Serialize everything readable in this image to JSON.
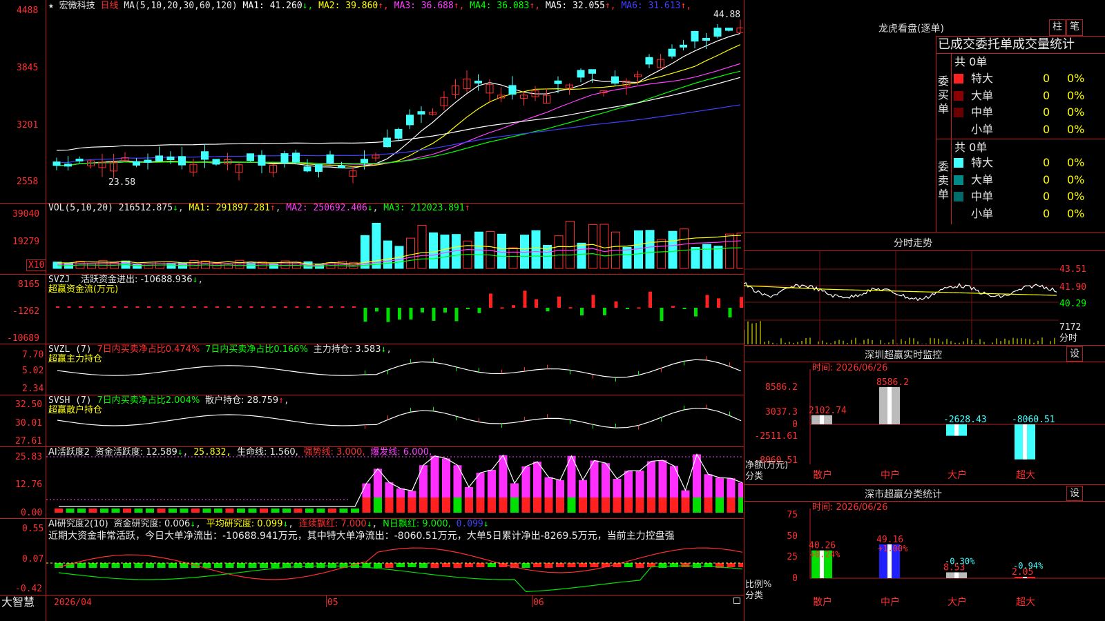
{
  "stock": {
    "name": "宏微科技",
    "period": "日线",
    "star": "★"
  },
  "main_chart": {
    "ma_header": "MA(5,10,20,30,60,120)",
    "ma": [
      {
        "label": "MA1: 41.260",
        "arrow": "↓",
        "color": "#ffffff"
      },
      {
        "label": "MA2: 39.860",
        "arrow": "↑",
        "color": "#ffff00"
      },
      {
        "label": "MA3: 36.688",
        "arrow": "↑",
        "color": "#ff40ff"
      },
      {
        "label": "MA4: 36.083",
        "arrow": "↑",
        "color": "#00ff00"
      },
      {
        "label": "MA5: 32.055",
        "arrow": "↑",
        "color": "#ffffff"
      },
      {
        "label": "MA6: 31.613",
        "arrow": "↑",
        "color": "#4040ff"
      }
    ],
    "y_ticks": [
      "4488",
      "3845",
      "3201",
      "2558"
    ],
    "high_marker": "44.88",
    "low_marker": "23.58"
  },
  "volume": {
    "header": "VOL(5,10,20)",
    "value": "216512.875",
    "ma1": "MA1: 291897.281",
    "ma2": "MA2: 250692.406",
    "ma3": "MA3: 212023.891",
    "y_ticks": [
      "39040",
      "19279"
    ],
    "unit": "X10"
  },
  "svzj": {
    "header": "SVZJ",
    "line": "活跃资金进出: -10688.936",
    "sub": "超赢资金流(万元)",
    "y_ticks": [
      "8165",
      "-1262",
      "-10689"
    ]
  },
  "svzl": {
    "header": "SVZL (7)",
    "a": "7日内买卖净占比0.474%",
    "b": "7日内买卖净占比0.166%",
    "c": "主力持仓: 3.583",
    "sub": "超赢主力持仓",
    "y_ticks": [
      "7.70",
      "5.02",
      "2.34"
    ]
  },
  "svsh": {
    "header": "SVSH (7)",
    "a": "7日内买卖净占比2.004%",
    "b": "散户持仓: 28.759",
    "sub": "超赢散户持仓",
    "y_ticks": [
      "32.50",
      "30.01",
      "27.61"
    ]
  },
  "ai_active": {
    "header": "AI活跃度2",
    "a": "资金活跃度: 12.589",
    "b": "25.832,",
    "c": "生命线: 1.560,",
    "d": "强势线: 3.000,",
    "e": "爆发线: 6.000,",
    "y_ticks": [
      "25.83",
      "12.76",
      "0.00"
    ]
  },
  "ai_research": {
    "header": "AI研究度2(10)",
    "a": "资金研究度: 0.006",
    "b": "平均研究度: 0.099",
    "c": "连续飘红: 7.000",
    "d": "N日飘红: 9.000,",
    "e": "0.099",
    "commentary": "近期大资金非常活跃，今日大单净流出：-10688.941万元，其中特大单净流出：-8060.51万元，大单5日累计净出-8269.5万元，当前主力控盘强",
    "y_ticks": [
      "0.55",
      "0.07",
      "-0.42"
    ]
  },
  "x_axis": {
    "brand": "大智慧",
    "labels": [
      "2026/04",
      "05",
      "06"
    ]
  },
  "longhu": {
    "title": "龙虎看盘(逐单)",
    "btn_bar": "柱",
    "btn_pen": "笔",
    "subtitle": "已成交委托单成交量统计",
    "buy_label": "委买单",
    "sell_label": "委卖单",
    "buy_total": "共 0单",
    "sell_total": "共 0单",
    "buy_rows": [
      {
        "name": "特大",
        "count": "0",
        "pct": "0%",
        "color": "#ff2020"
      },
      {
        "name": "大单",
        "count": "0",
        "pct": "0%",
        "color": "#8b0000"
      },
      {
        "name": "中单",
        "count": "0",
        "pct": "0%",
        "color": "#6b0000"
      },
      {
        "name": "小单",
        "count": "0",
        "pct": "0%",
        "color": "#000000"
      }
    ],
    "sell_rows": [
      {
        "name": "特大",
        "count": "0",
        "pct": "0%",
        "color": "#40ffff"
      },
      {
        "name": "大单",
        "count": "0",
        "pct": "0%",
        "color": "#008b8b"
      },
      {
        "name": "中单",
        "count": "0",
        "pct": "0%",
        "color": "#006b6b"
      },
      {
        "name": "小单",
        "count": "0",
        "pct": "0%",
        "color": "#000000"
      }
    ]
  },
  "intraday": {
    "title": "分时走势",
    "y_ticks": [
      "43.51",
      "41.90",
      "40.29"
    ],
    "vol_label": "7172",
    "vol_unit": "分时"
  },
  "sz_monitor": {
    "title": "深圳超赢实时监控",
    "btn": "设",
    "time": "时间: 2026/06/26",
    "y_ticks": [
      "8586.2",
      "3037.3",
      "0",
      "-2511.61",
      "-8060.51"
    ],
    "y_label": "净额(万元)",
    "x_label": "分类",
    "bars": [
      {
        "label": "散户",
        "value": 2102.74,
        "text": "2102.74"
      },
      {
        "label": "中户",
        "value": 8586.2,
        "text": "8586.2"
      },
      {
        "label": "大户",
        "value": -2628.43,
        "text": "-2628.43"
      },
      {
        "label": "超大",
        "value": -8060.51,
        "text": "-8060.51"
      }
    ]
  },
  "sz_stats": {
    "title": "深市超赢分类统计",
    "btn": "设",
    "time": "时间: 2026/06/26",
    "y_ticks": [
      "75",
      "50",
      "25",
      "0"
    ],
    "y_label": "比例%",
    "x_label": "分类",
    "bars": [
      {
        "label": "散户",
        "value": 40.26,
        "text": "40.26",
        "change": "+0.24%"
      },
      {
        "label": "中户",
        "value": 49.16,
        "text": "49.16",
        "change": "+1.00%"
      },
      {
        "label": "大户",
        "value": 8.53,
        "text": "8.53",
        "change": "-0.30%"
      },
      {
        "label": "超大",
        "value": 2.05,
        "text": "2.05",
        "change": "-0.94%"
      }
    ]
  }
}
